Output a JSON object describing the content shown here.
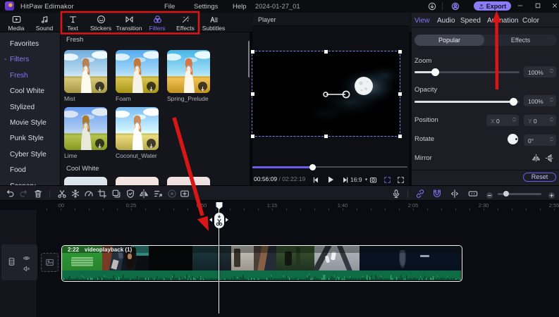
{
  "titlebar": {
    "app_title": "HitPaw Edimakor",
    "menus": [
      "File",
      "Settings",
      "Help"
    ],
    "document_title": "2024-01-27_01",
    "export_label": "Export",
    "window_controls": [
      "minimize",
      "maximize",
      "close"
    ]
  },
  "ribbon": {
    "tabs": [
      {
        "label": "Media",
        "icon": "media-icon",
        "active": false
      },
      {
        "label": "Sound",
        "icon": "sound-icon",
        "active": false
      },
      {
        "label": "Text",
        "icon": "text-icon",
        "active": false
      },
      {
        "label": "Stickers",
        "icon": "stickers-icon",
        "active": false
      },
      {
        "label": "Transition",
        "icon": "transition-icon",
        "active": false
      },
      {
        "label": "Filters",
        "icon": "filters-icon",
        "active": true
      },
      {
        "label": "Effects",
        "icon": "effects-icon",
        "active": false
      },
      {
        "label": "Subtitles",
        "icon": "subtitles-icon",
        "active": false
      }
    ]
  },
  "sidebar": {
    "items": [
      {
        "label": "Favorites",
        "selected": false,
        "expanded": false
      },
      {
        "label": "Filters",
        "selected": true,
        "expanded": true
      },
      {
        "label": "Fresh",
        "selected": true,
        "child": true
      },
      {
        "label": "Cool White",
        "selected": false,
        "child": true
      },
      {
        "label": "Stylized",
        "selected": false,
        "child": true
      },
      {
        "label": "Movie Style",
        "selected": false,
        "child": true
      },
      {
        "label": "Punk Style",
        "selected": false,
        "child": true
      },
      {
        "label": "Cyber Style",
        "selected": false,
        "child": true
      },
      {
        "label": "Food",
        "selected": false,
        "child": true
      },
      {
        "label": "Scenery",
        "selected": false,
        "child": true
      }
    ]
  },
  "library": {
    "groups": [
      {
        "title": "Fresh",
        "items": [
          "Mist",
          "Foam",
          "Spring_Prelude",
          "Lime",
          "Coconut_Water"
        ]
      },
      {
        "title": "Cool White",
        "items": [
          "",
          "",
          ""
        ]
      }
    ]
  },
  "player": {
    "panel_title": "Player",
    "current_time": "00:56:09",
    "time_separator": " / ",
    "total_time": "02:22:19",
    "aspect_ratio": "16:9",
    "progress_percent": 39,
    "controls": [
      "previous-frame",
      "play",
      "next-frame",
      "aspect-ratio-dropdown",
      "snapshot",
      "crop",
      "fullscreen"
    ]
  },
  "inspector": {
    "tabs": [
      "View",
      "Audio",
      "Speed",
      "Animation",
      "Color"
    ],
    "active_tab": "View",
    "segmented": {
      "options": [
        "Popular",
        "Effects"
      ],
      "selected": "Popular"
    },
    "zoom": {
      "label": "Zoom",
      "value": "100%",
      "slider_percent": 20
    },
    "opacity": {
      "label": "Opacity",
      "value": "100%",
      "slider_percent": 94
    },
    "position": {
      "label": "Position",
      "x_axis": "X",
      "x_value": "0",
      "y_axis": "Y",
      "y_value": "0"
    },
    "rotate": {
      "label": "Rotate",
      "value": "0°"
    },
    "mirror": {
      "label": "Mirror",
      "icons": [
        "flip-horizontal-icon",
        "flip-vertical-icon"
      ]
    },
    "reset_label": "Reset"
  },
  "timeline_toolbar": {
    "left_icons": [
      {
        "name": "undo-icon",
        "state": "normal"
      },
      {
        "name": "redo-icon",
        "state": "disabled"
      },
      {
        "name": "delete-icon",
        "state": "normal"
      },
      {
        "name": "split-icon",
        "state": "normal"
      },
      {
        "name": "freeze-frame-icon",
        "state": "normal"
      },
      {
        "name": "speed-icon",
        "state": "normal"
      },
      {
        "name": "crop-icon",
        "state": "normal"
      },
      {
        "name": "copy-icon",
        "state": "normal"
      },
      {
        "name": "mask-icon",
        "state": "normal"
      },
      {
        "name": "mirror-icon",
        "state": "normal"
      },
      {
        "name": "motion-icon",
        "state": "normal"
      },
      {
        "name": "record-icon",
        "state": "disabled"
      },
      {
        "name": "add-to-track-icon",
        "state": "normal"
      }
    ],
    "right_icons": [
      {
        "name": "microphone-icon",
        "state": "normal"
      },
      {
        "name": "link-icon",
        "state": "accent"
      },
      {
        "name": "magnet-icon",
        "state": "accent"
      },
      {
        "name": "split-marker-icon",
        "state": "normal"
      },
      {
        "name": "auto-ripple-icon",
        "state": "normal"
      }
    ],
    "zoom_out": "zoom-out-icon",
    "zoom_in": "zoom-in-icon",
    "zoom_slider_percent": 14
  },
  "timeline": {
    "ruler_labels": [
      ":00",
      "0:25",
      "0:50",
      "1:15",
      "1:40",
      "2:05",
      "2:30",
      "2:55"
    ],
    "track": {
      "icons": [
        "film-track-icon",
        "visibility-icon",
        "mute-icon"
      ]
    },
    "clip": {
      "duration": "2:22",
      "name": "videoplayback (1)"
    }
  },
  "annotations": {
    "highlight_color": "#d81616",
    "tabs_box": true,
    "arrow_to_playhead": true,
    "arrow_to_export": true
  }
}
